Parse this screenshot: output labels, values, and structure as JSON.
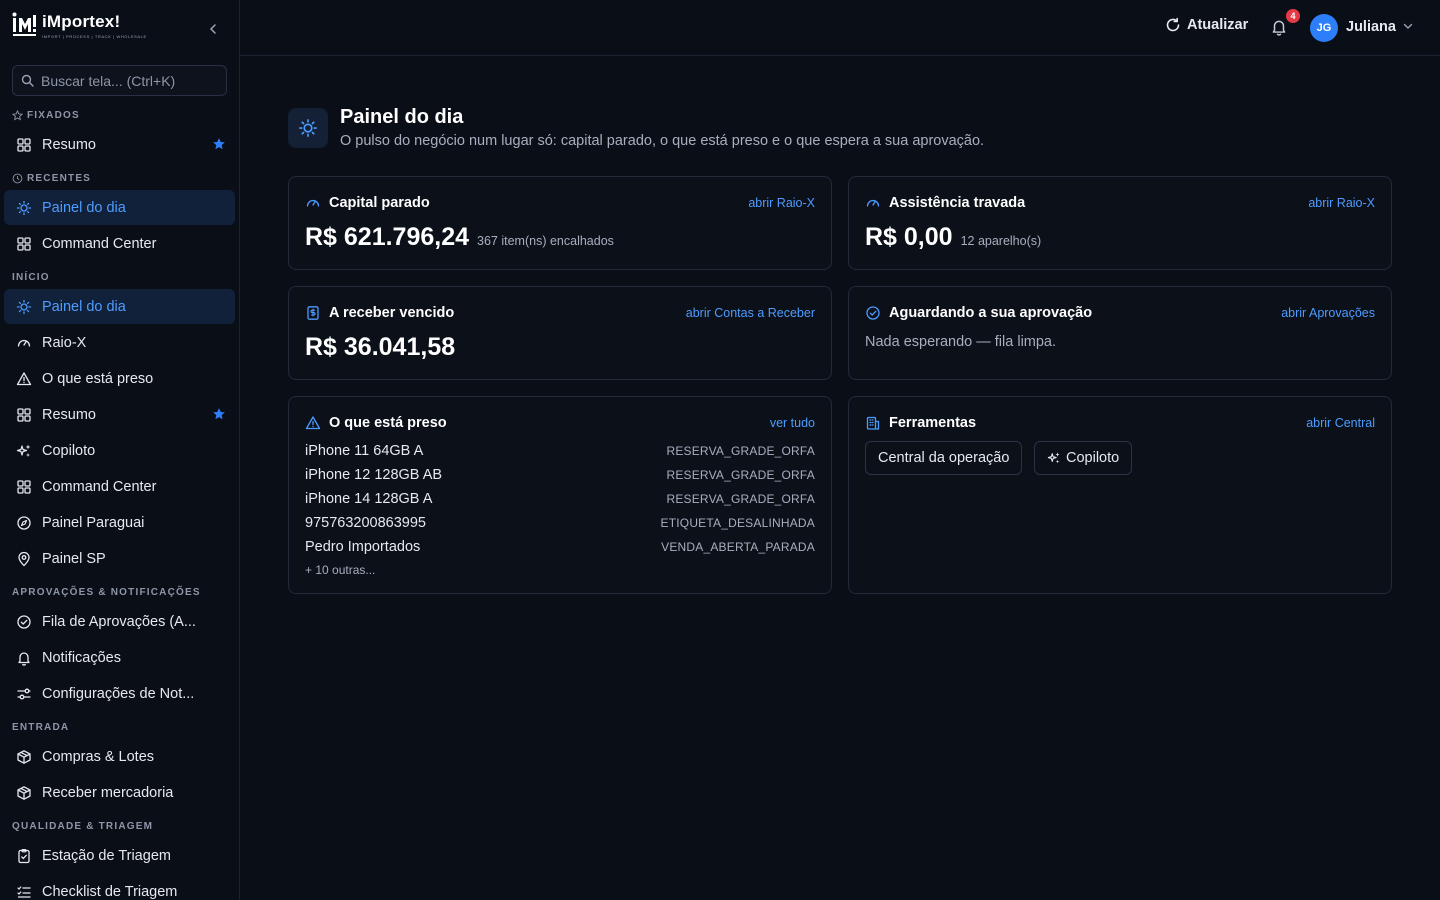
{
  "brand": {
    "name": "iMportex!",
    "tagline": "IMPORT | PROCESS | TRACK | WHOLESALE"
  },
  "sidebar": {
    "search_placeholder": "Buscar tela... (Ctrl+K)",
    "sections": {
      "fixados": "FIXADOS",
      "recentes": "RECENTES",
      "inicio": "INÍCIO",
      "aprovacoes": "APROVAÇÕES & NOTIFICAÇÕES",
      "entrada": "ENTRADA",
      "qualidade": "QUALIDADE & TRIAGEM"
    },
    "fixados": [
      {
        "label": "Resumo",
        "icon": "grid-icon",
        "starred": true
      }
    ],
    "recentes": [
      {
        "label": "Painel do dia",
        "icon": "sun-icon",
        "active": true
      },
      {
        "label": "Command Center",
        "icon": "grid-icon"
      }
    ],
    "inicio": [
      {
        "label": "Painel do dia",
        "icon": "sun-icon",
        "active": true
      },
      {
        "label": "Raio-X",
        "icon": "gauge-icon"
      },
      {
        "label": "O que está preso",
        "icon": "warning-icon"
      },
      {
        "label": "Resumo",
        "icon": "grid-icon",
        "starred": true
      },
      {
        "label": "Copiloto",
        "icon": "sparkles-icon"
      },
      {
        "label": "Command Center",
        "icon": "grid-icon"
      },
      {
        "label": "Painel Paraguai",
        "icon": "compass-icon"
      },
      {
        "label": "Painel SP",
        "icon": "map-pin-icon"
      }
    ],
    "aprovacoes": [
      {
        "label": "Fila de Aprovações (A...",
        "icon": "check-circle-icon"
      },
      {
        "label": "Notificações",
        "icon": "bell-icon"
      },
      {
        "label": "Configurações de Not...",
        "icon": "sliders-icon"
      }
    ],
    "entrada": [
      {
        "label": "Compras & Lotes",
        "icon": "package-icon"
      },
      {
        "label": "Receber mercadoria",
        "icon": "package-icon"
      }
    ],
    "qualidade": [
      {
        "label": "Estação de Triagem",
        "icon": "clipboard-check-icon"
      },
      {
        "label": "Checklist de Triagem",
        "icon": "list-check-icon"
      }
    ]
  },
  "topbar": {
    "refresh_label": "Atualizar",
    "notification_count": "4",
    "user_initials": "JG",
    "user_name": "Juliana"
  },
  "page": {
    "title": "Painel do dia",
    "subtitle": "O pulso do negócio num lugar só: capital parado, o que está preso e o que espera a sua aprovação."
  },
  "cards": {
    "capital": {
      "title": "Capital parado",
      "link": "abrir Raio-X",
      "value": "R$ 621.796,24",
      "note": "367 item(ns) encalhados"
    },
    "assistencia": {
      "title": "Assistência travada",
      "link": "abrir Raio-X",
      "value": "R$ 0,00",
      "note": "12 aparelho(s)"
    },
    "receber": {
      "title": "A receber vencido",
      "link": "abrir Contas a Receber",
      "value": "R$ 36.041,58"
    },
    "aprovacao": {
      "title": "Aguardando a sua aprovação",
      "link": "abrir Aprovações",
      "empty": "Nada esperando — fila limpa."
    },
    "preso": {
      "title": "O que está preso",
      "link": "ver tudo",
      "items": [
        {
          "name": "iPhone 11 64GB A",
          "code": "RESERVA_GRADE_ORFA"
        },
        {
          "name": "iPhone 12 128GB AB",
          "code": "RESERVA_GRADE_ORFA"
        },
        {
          "name": "iPhone 14 128GB A",
          "code": "RESERVA_GRADE_ORFA"
        },
        {
          "name": "975763200863995",
          "code": "ETIQUETA_DESALINHADA"
        },
        {
          "name": "Pedro Importados",
          "code": "VENDA_ABERTA_PARADA"
        }
      ],
      "more": "+ 10 outras..."
    },
    "ferramentas": {
      "title": "Ferramentas",
      "link": "abrir Central",
      "buttons": {
        "central": "Central da operação",
        "copiloto": "Copiloto"
      }
    }
  },
  "colors": {
    "accent": "#4d9cff",
    "background": "#0a0e17",
    "card_border": "#222a3a",
    "badge": "#e53946",
    "avatar": "#2d7ff9"
  }
}
